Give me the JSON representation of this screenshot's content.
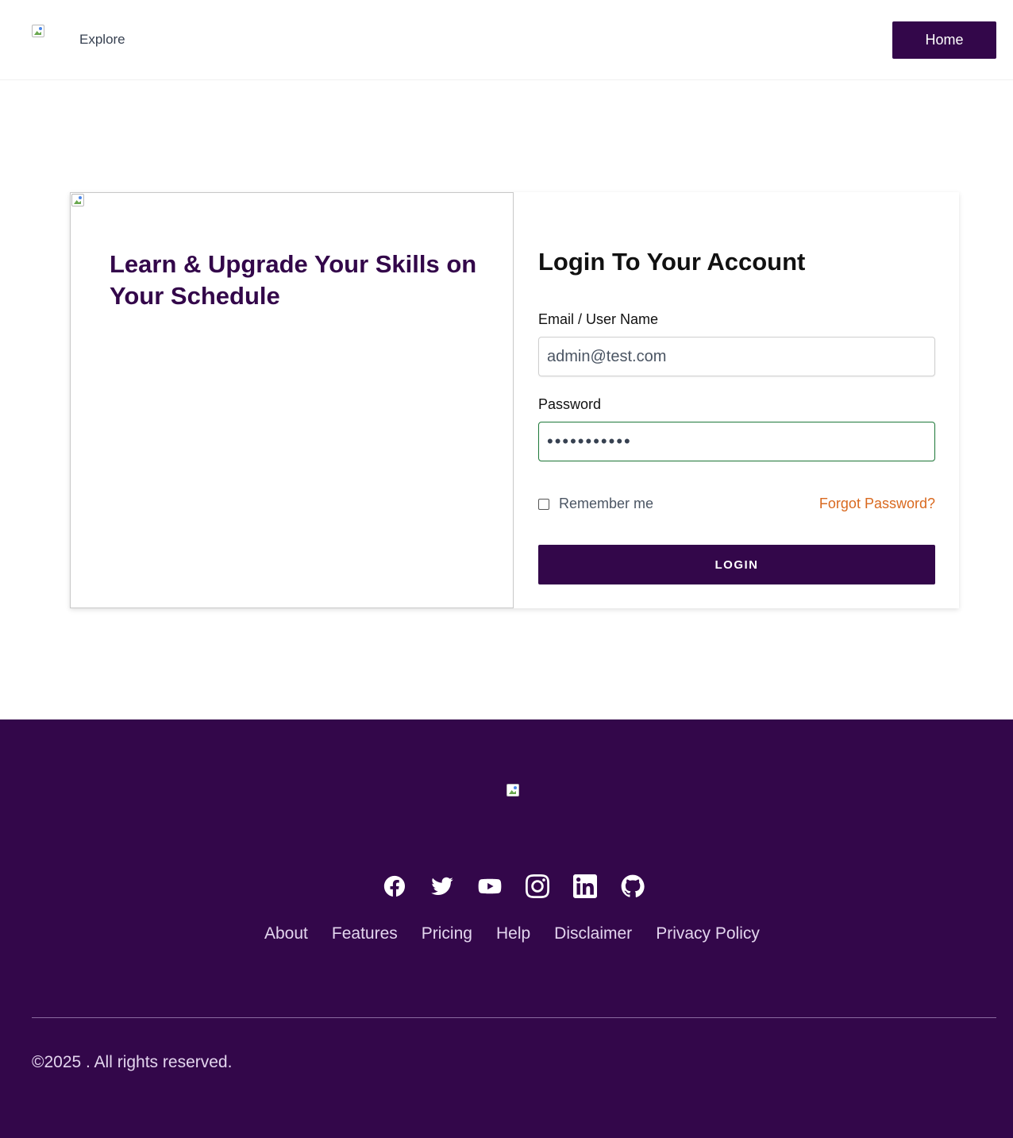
{
  "header": {
    "nav_explore": "Explore",
    "home_button": "Home"
  },
  "hero": {
    "tagline": "Learn & Upgrade Your Skills on Your Schedule"
  },
  "login_form": {
    "title": "Login To Your Account",
    "email_label": "Email / User Name",
    "email_value": "admin@test.com",
    "password_label": "Password",
    "password_value": "•••••••••••",
    "remember_label": "Remember me",
    "remember_checked": false,
    "forgot_link": "Forgot Password?",
    "login_button": "LOGIN"
  },
  "footer": {
    "social_icons": [
      "facebook-icon",
      "twitter-icon",
      "youtube-icon",
      "instagram-icon",
      "linkedin-icon",
      "github-icon"
    ],
    "links": [
      "About",
      "Features",
      "Pricing",
      "Help",
      "Disclaimer",
      "Privacy Policy"
    ],
    "copyright": "©2025 . All rights reserved."
  },
  "colors": {
    "brand_purple": "#33074a",
    "link_orange": "#d9691f",
    "focus_green": "#1f7a3a"
  }
}
